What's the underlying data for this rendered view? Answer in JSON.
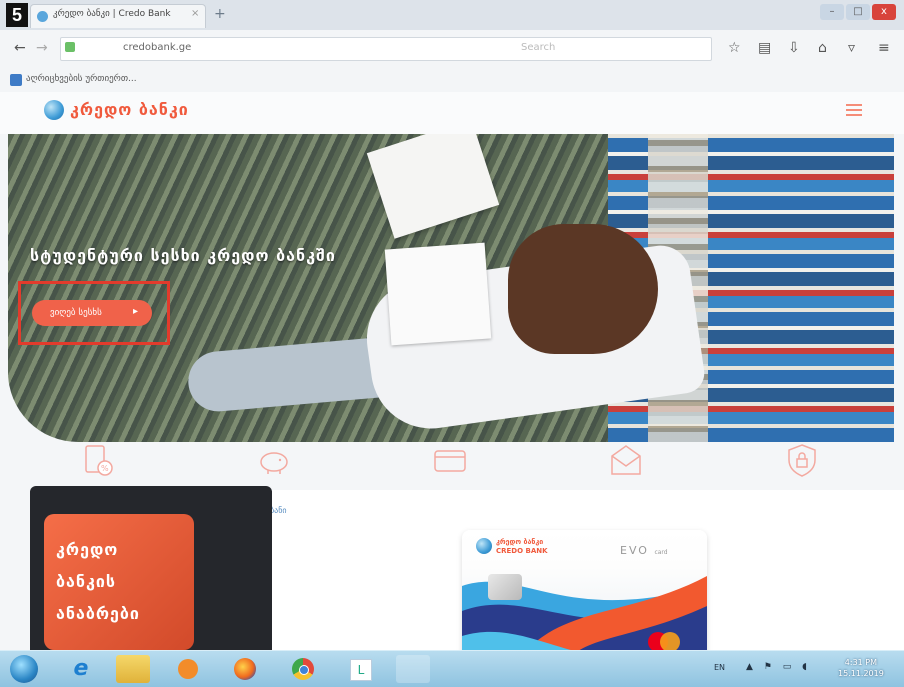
{
  "step_number": "5",
  "browser": {
    "tab_title": "კრედო ბანკი | Credo Bank",
    "tab_close": "×",
    "new_tab": "+",
    "url": "credobank.ge",
    "search_placeholder": "Search",
    "window_controls": {
      "minimize": "–",
      "maximize": "□",
      "close": "x"
    },
    "bookmark_label": "აღრიცხვების ურთიერთ...",
    "toolbar_icons": [
      "star-icon",
      "library-icon",
      "download-icon",
      "home-icon",
      "pocket-icon",
      "menu-icon"
    ]
  },
  "site": {
    "logo_text": "კრედო ბანკი",
    "hero_title": "სტუდენტური სესხი კრედო ბანკში",
    "hero_button_label": "ვიღებ სესხს",
    "hero_button_arrow": "▸",
    "service_icons": [
      "loan-percent-icon",
      "piggy-bank-icon",
      "card-icon",
      "envelope-icon",
      "shield-lock-icon"
    ],
    "content_link_text": "ბანი",
    "promo_lines": [
      "კრედო",
      "ბანკის",
      "ანაბრები"
    ],
    "card_brand_ka": "კრედო ბანკი",
    "card_brand_en": "CREDO BANK",
    "card_product": "EVO",
    "card_product_suffix": "card"
  },
  "taskbar": {
    "apps": [
      "start-button",
      "ie-icon",
      "explorer-icon",
      "media-player-icon",
      "firefox-icon",
      "chrome-icon",
      "lync-icon",
      "app-icon"
    ],
    "language": "EN",
    "time": "4:31 PM",
    "date": "15.11.2019"
  },
  "colors": {
    "brand_orange": "#f05a3d",
    "highlight_red": "#e23b2c",
    "taskbar_blue": "#9fcce6"
  }
}
